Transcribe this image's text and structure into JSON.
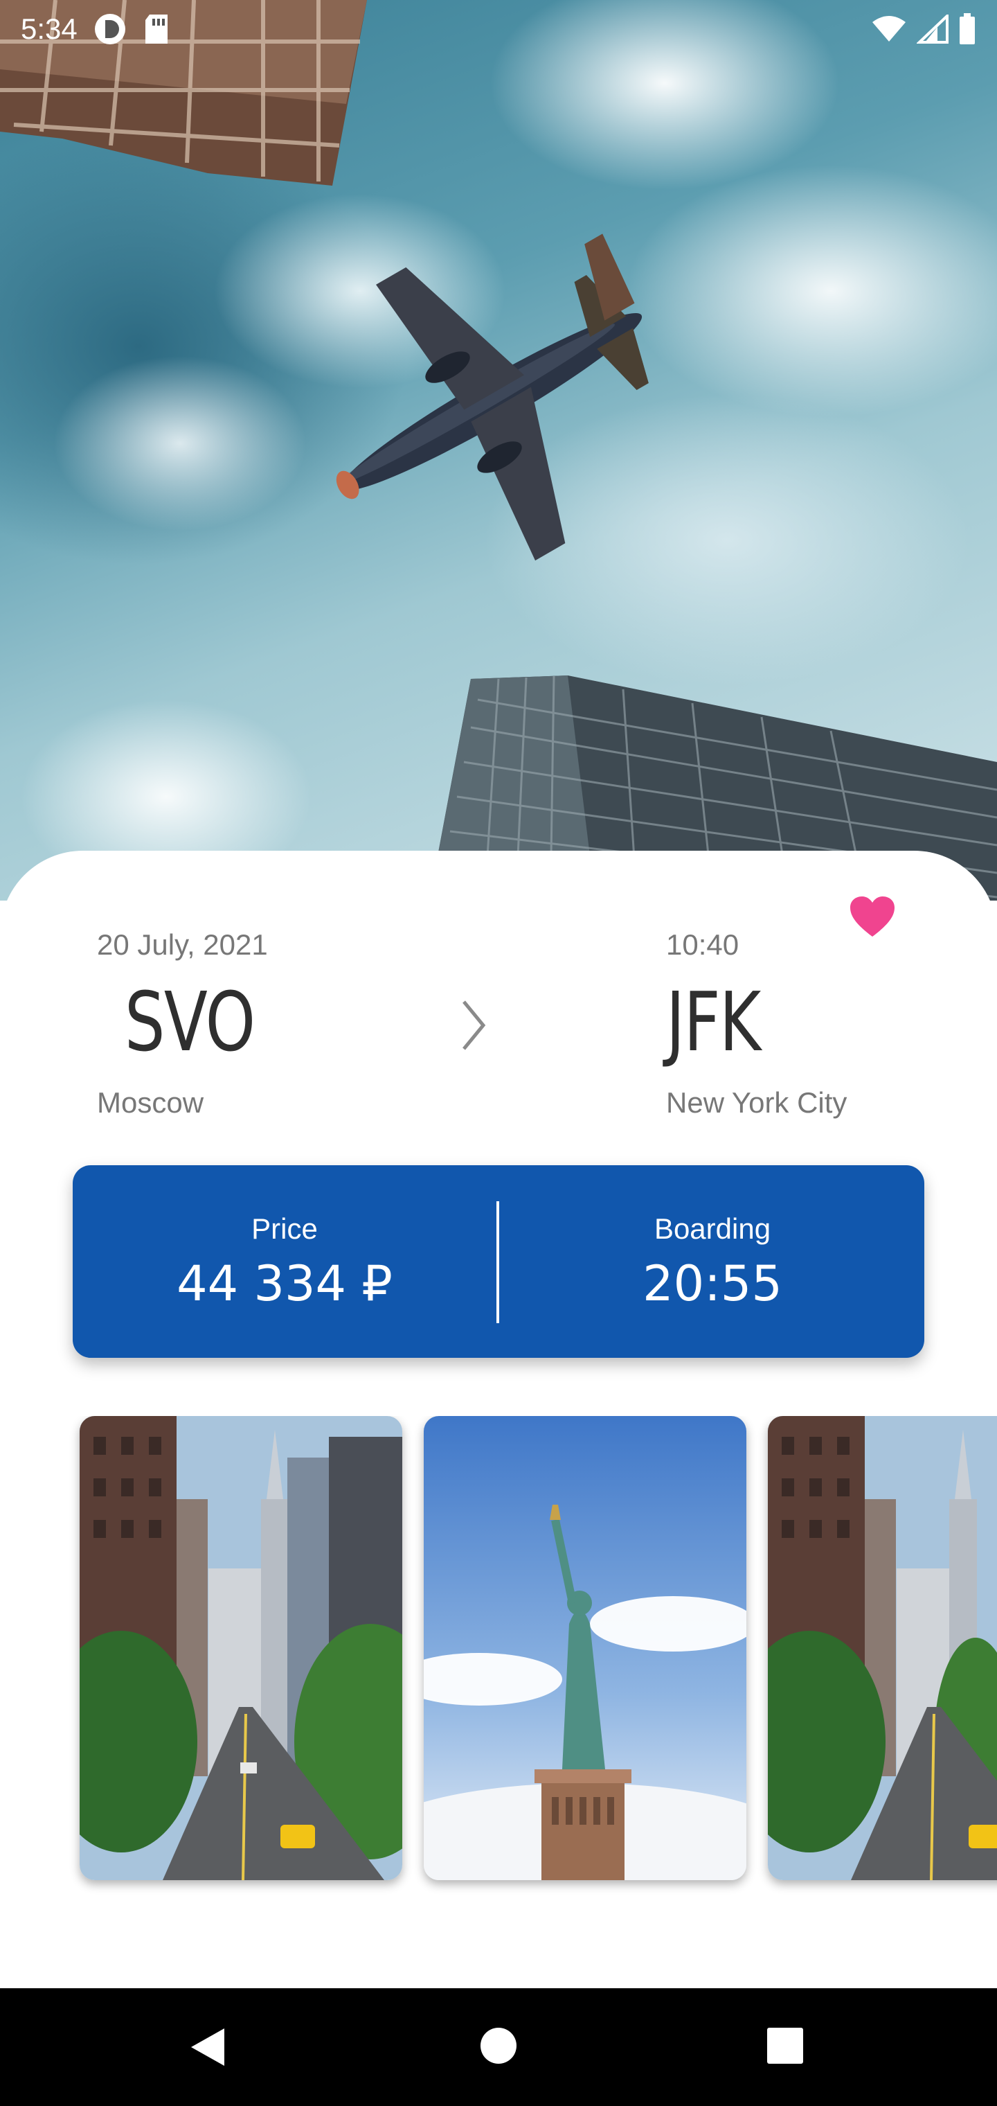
{
  "status_bar": {
    "time": "5:34",
    "icons": [
      "privacy-icon",
      "sd-card-icon",
      "wifi-icon",
      "signal-icon",
      "battery-icon"
    ]
  },
  "hero": {
    "image": "airplane-over-skyscrapers"
  },
  "flight": {
    "favorite": true,
    "date": "20 July, 2021",
    "time": "10:40",
    "from_code": "SVO",
    "to_code": "JFK",
    "from_city": "Moscow",
    "to_city": "New York City"
  },
  "info": {
    "price_label": "Price",
    "price_value": "44 334 ₽",
    "boarding_label": "Boarding",
    "boarding_value": "20:55"
  },
  "gallery": {
    "photos": [
      "manhattan-street",
      "statue-of-liberty",
      "manhattan-street"
    ]
  },
  "colors": {
    "accent": "#1157ad",
    "heart": "#f0448f",
    "text_primary": "#2f2f2f",
    "text_secondary": "#777777"
  },
  "nav": {
    "icons": [
      "back-icon",
      "home-icon",
      "recents-icon"
    ]
  }
}
